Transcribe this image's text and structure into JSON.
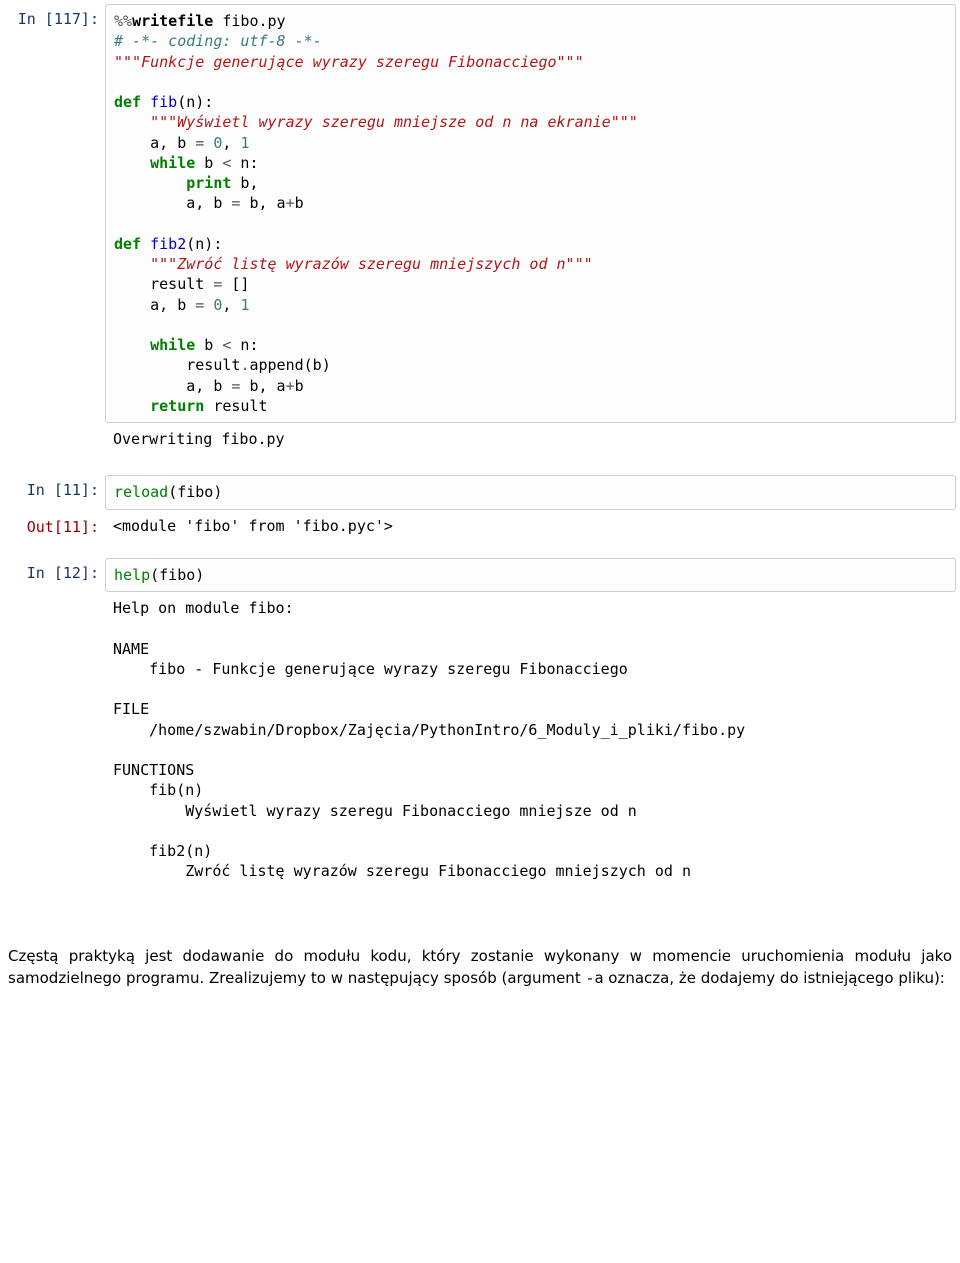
{
  "cell117": {
    "prompt": "In [117]:",
    "code": {
      "l1a": "%%",
      "l1b": "writefile",
      "l1c": " fibo.py",
      "l2": "# -*- coding: utf-8 -*-",
      "l3": "\"\"\"Funkcje generujące wyrazy szeregu Fibonacciego\"\"\"",
      "l5_def": "def",
      "l5_name": " fib",
      "l5_sig": "(n):",
      "l6": "\"\"\"Wyświetl wyrazy szeregu mniejsze od n na ekranie\"\"\"",
      "l7a": "a, b ",
      "l7b": "=",
      "l7c": " ",
      "l7d": "0",
      "l7e": ", ",
      "l7f": "1",
      "l8a": "while",
      "l8b": " b ",
      "l8c": "<",
      "l8d": " n:",
      "l9a": "print",
      "l9b": " b,",
      "l10a": "a, b ",
      "l10b": "=",
      "l10c": " b, a",
      "l10d": "+",
      "l10e": "b",
      "l12_def": "def",
      "l12_name": " fib2",
      "l12_sig": "(n):",
      "l13": "\"\"\"Zwróć listę wyrazów szeregu mniejszych od n\"\"\"",
      "l14a": "result ",
      "l14b": "=",
      "l14c": " []",
      "l15a": "a, b ",
      "l15b": "=",
      "l15c": " ",
      "l15d": "0",
      "l15e": ", ",
      "l15f": "1",
      "l17a": "while",
      "l17b": " b ",
      "l17c": "<",
      "l17d": " n:",
      "l18a": "result",
      "l18b": ".",
      "l18c": "append(b)",
      "l19a": "a, b ",
      "l19b": "=",
      "l19c": " b, a",
      "l19d": "+",
      "l19e": "b",
      "l20a": "return",
      "l20b": " result"
    },
    "output": "Overwriting fibo.py"
  },
  "cell11in": {
    "prompt": "In [11]:",
    "code": {
      "a": "reload",
      "b": "(fibo)"
    }
  },
  "cell11out": {
    "prompt": "Out[11]:",
    "text": "<module 'fibo' from 'fibo.pyc'>"
  },
  "cell12": {
    "prompt": "In [12]:",
    "code": {
      "a": "help",
      "b": "(fibo)"
    },
    "output_lines": {
      "l1": "Help on module fibo:",
      "l3": "NAME",
      "l4": "    fibo - Funkcje generujące wyrazy szeregu Fibonacciego",
      "l6": "FILE",
      "l7": "    /home/szwabin/Dropbox/Zajęcia/PythonIntro/6_Moduly_i_pliki/fibo.py",
      "l9": "FUNCTIONS",
      "l10": "    fib(n)",
      "l11": "        Wyświetl wyrazy szeregu Fibonacciego mniejsze od n",
      "l13": "    fib2(n)",
      "l14": "        Zwróć listę wyrazów szeregu Fibonacciego mniejszych od n"
    }
  },
  "paragraph": {
    "p1": "Częstą praktyką jest dodawanie do modułu kodu, który zostanie wykonany w momencie uruchomienia modułu jako samodzielnego programu. Zrealizujemy to w następujący sposób (argument ",
    "p2": "-a",
    "p3": " oznacza, że dodajemy do istniejącego pliku):"
  }
}
